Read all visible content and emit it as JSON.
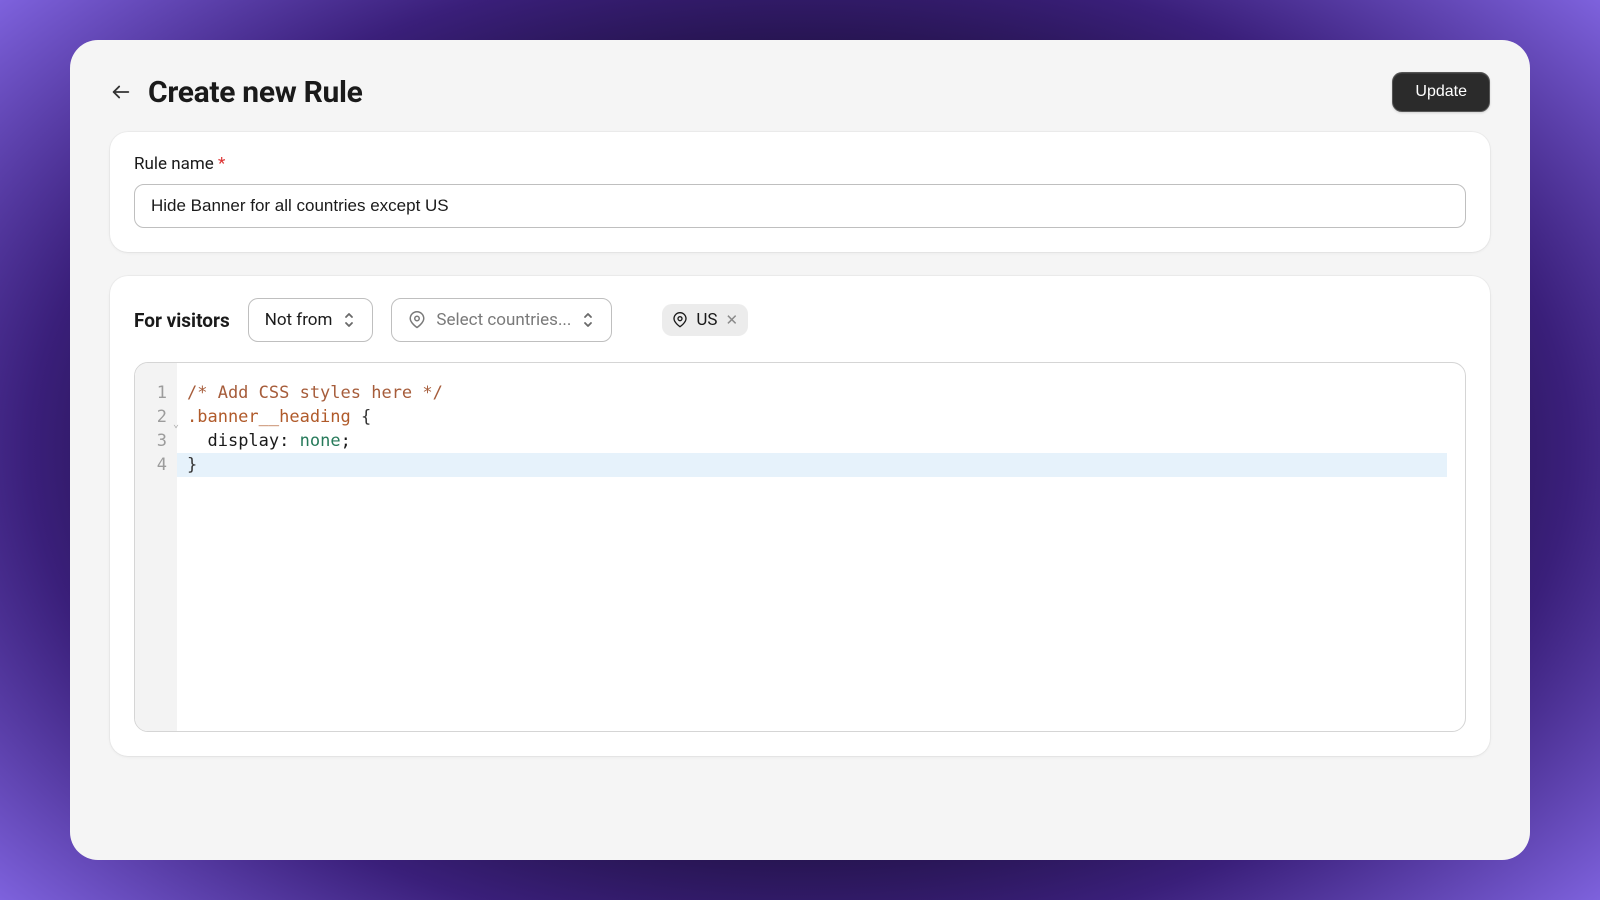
{
  "header": {
    "title": "Create new Rule",
    "update_label": "Update"
  },
  "rule_name": {
    "label": "Rule name",
    "required_mark": "*",
    "value": "Hide Banner for all countries except US"
  },
  "visitors": {
    "for_label": "For visitors",
    "mode_label": "Not from",
    "country_select_placeholder": "Select countries...",
    "chips": [
      {
        "label": "US"
      }
    ]
  },
  "editor": {
    "lines": [
      {
        "n": "1",
        "type": "comment",
        "text": "/* Add CSS styles here */"
      },
      {
        "n": "2",
        "type": "selector-open",
        "selector": ".banner__heading",
        "brace": " {",
        "fold": true
      },
      {
        "n": "3",
        "type": "decl",
        "indent": "  ",
        "prop": "display",
        "colon": ": ",
        "value": "none",
        "semi": ";"
      },
      {
        "n": "4",
        "type": "close",
        "brace": "}",
        "highlight": true
      }
    ]
  }
}
